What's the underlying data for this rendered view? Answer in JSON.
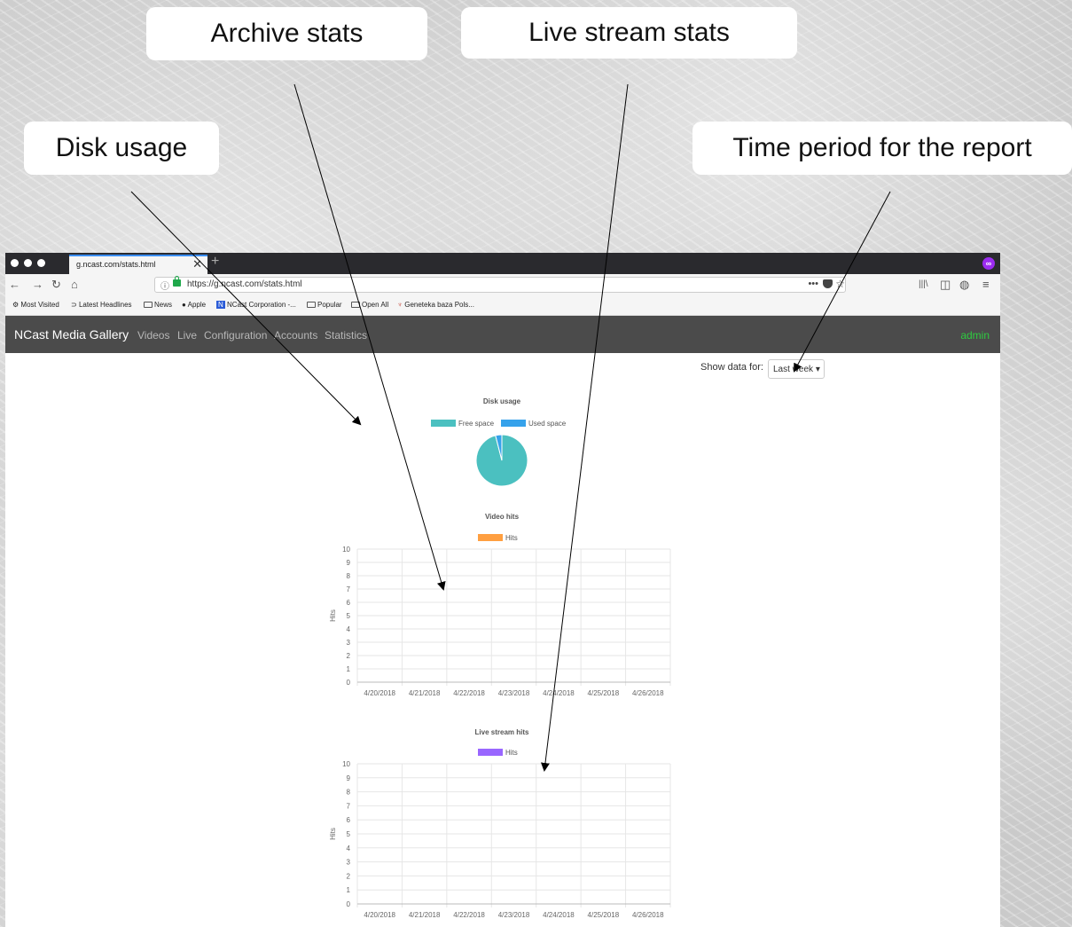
{
  "callouts": {
    "archive": "Archive stats",
    "live": "Live stream stats",
    "disk": "Disk usage",
    "period": "Time period for the report"
  },
  "browser": {
    "tab_title": "g.ncast.com/stats.html",
    "close_glyph": "✕",
    "newtab_glyph": "+",
    "url": "https://g.ncast.com/stats.html",
    "url_info_glyph": "ⓘ",
    "url_more": "•••",
    "url_star": "☆",
    "ext_glyph": "∞",
    "nav_icons": {
      "back": "←",
      "forward": "→",
      "reload": "↻",
      "home": "⌂",
      "library": "|||\\",
      "sidebar": "◫",
      "account": "◍",
      "menu": "≡"
    },
    "bookmarks": [
      "Most Visited",
      "Latest Headlines",
      "News",
      "Apple",
      "NCast Corporation -...",
      "Popular",
      "Open All",
      "Geneteka baza Pols..."
    ],
    "bookmark_icons": {
      "gear": "⚙",
      "rss": "⊃",
      "apple": "●",
      "ncast": "N",
      "geneteka": "♆"
    }
  },
  "app": {
    "brand": "NCast Media Gallery",
    "menu": [
      "Videos",
      "Live",
      "Configuration",
      "Accounts",
      "Statistics"
    ],
    "user": "admin",
    "filter_label": "Show data for:",
    "filter_value": "Last week",
    "caret": "▾"
  },
  "colors": {
    "free": "#4bc0c0",
    "used": "#36a2eb",
    "video": "#ff9f40",
    "live": "#9966ff"
  },
  "chart_data": [
    {
      "type": "pie",
      "title": "Disk usage",
      "categories": [
        "Free space",
        "Used space"
      ],
      "values": [
        96,
        4
      ]
    },
    {
      "type": "bar",
      "title": "Video hits",
      "categories": [
        "4/20/2018",
        "4/21/2018",
        "4/22/2018",
        "4/23/2018",
        "4/24/2018",
        "4/25/2018",
        "4/26/2018"
      ],
      "series": [
        {
          "name": "Hits",
          "values": [
            0,
            0,
            0,
            0,
            0,
            0,
            0
          ]
        }
      ],
      "ylabel": "Hits",
      "ylim": [
        0,
        10
      ],
      "yticks": [
        "0",
        "1",
        "2",
        "3",
        "4",
        "5",
        "6",
        "7",
        "8",
        "9",
        "10"
      ],
      "grid": true,
      "legend": "top"
    },
    {
      "type": "bar",
      "title": "Live stream hits",
      "categories": [
        "4/20/2018",
        "4/21/2018",
        "4/22/2018",
        "4/23/2018",
        "4/24/2018",
        "4/25/2018",
        "4/26/2018"
      ],
      "series": [
        {
          "name": "Hits",
          "values": [
            0,
            0,
            0,
            0,
            0,
            0,
            0
          ]
        }
      ],
      "ylabel": "Hits",
      "ylim": [
        0,
        10
      ],
      "yticks": [
        "0",
        "1",
        "2",
        "3",
        "4",
        "5",
        "6",
        "7",
        "8",
        "9",
        "10"
      ],
      "grid": true,
      "legend": "top"
    }
  ]
}
